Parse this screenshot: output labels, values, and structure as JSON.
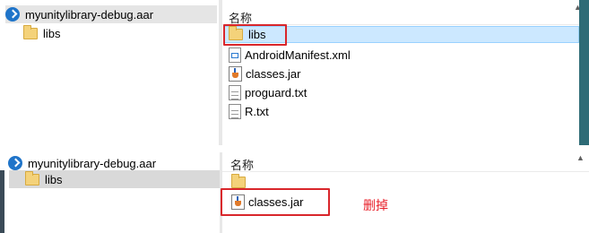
{
  "top": {
    "tree": [
      {
        "label": "myunitylibrary-debug.aar",
        "icon": "aar-icon"
      },
      {
        "label": "libs",
        "icon": "folder-icon"
      }
    ],
    "column_header": "名称",
    "files": [
      {
        "label": "libs",
        "icon": "folder-icon"
      },
      {
        "label": "AndroidManifest.xml",
        "icon": "xml-file-icon"
      },
      {
        "label": "classes.jar",
        "icon": "jar-file-icon"
      },
      {
        "label": "proguard.txt",
        "icon": "text-file-icon"
      },
      {
        "label": "R.txt",
        "icon": "text-file-icon"
      }
    ]
  },
  "bottom": {
    "tree": [
      {
        "label": "myunitylibrary-debug.aar",
        "icon": "aar-icon"
      },
      {
        "label": "libs",
        "icon": "folder-icon"
      }
    ],
    "column_header": "名称",
    "files": [
      {
        "label": "..",
        "icon": "folder-icon"
      },
      {
        "label": "classes.jar",
        "icon": "jar-file-icon"
      }
    ]
  },
  "annotation": "删掉",
  "colors": {
    "highlight": "#cce8ff",
    "red_box": "#d9262b",
    "annotation_text": "#e8202a",
    "dark_edge": "#3a4a57"
  }
}
